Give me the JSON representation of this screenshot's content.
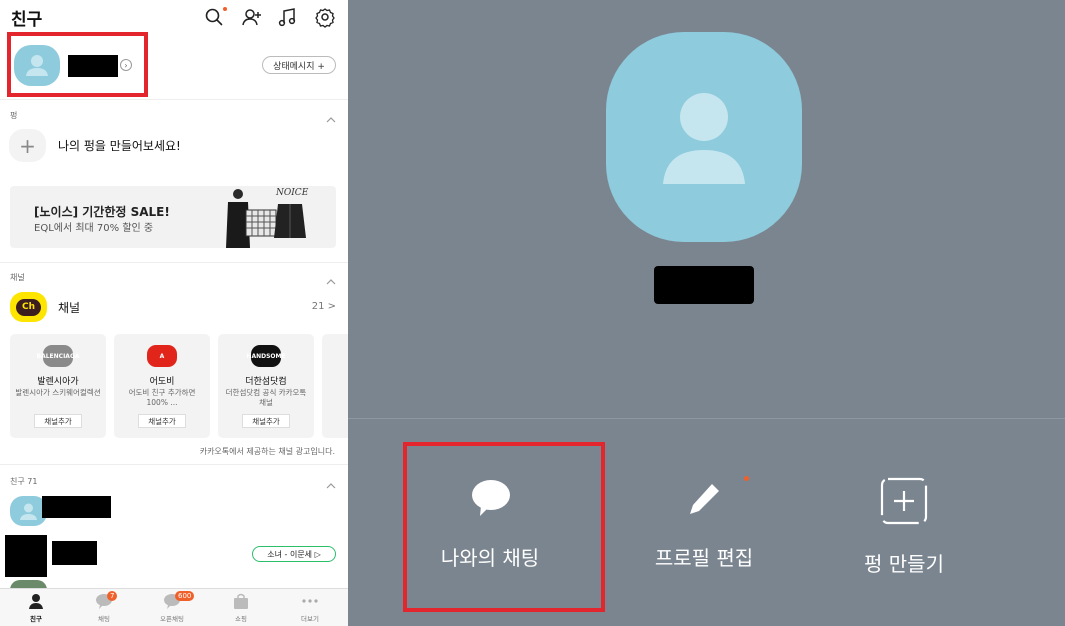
{
  "left": {
    "header": {
      "title": "친구",
      "icons": [
        "search-icon",
        "add-friend-icon",
        "music-icon",
        "settings-icon"
      ]
    },
    "profile": {
      "status_button": "상태메시지 +"
    },
    "pyeong": {
      "section_label": "펑",
      "create_text": "나의 펑을 만들어보세요!"
    },
    "banner": {
      "title": "[노이스] 기간한정 SALE!",
      "subtitle": "EQL에서 최대 70% 할인 중",
      "brand": "NOICE"
    },
    "channel": {
      "section_label": "채널",
      "logo_text": "Ch",
      "title": "채널",
      "count": "21 >",
      "cards": [
        {
          "name": "발렌시아가",
          "desc": "발렌시아가 스키웨어컬렉션",
          "button": "채널추가",
          "logo_text": "BALENCIAGA",
          "logo_color": "#8a8a8a"
        },
        {
          "name": "어도비",
          "desc": "어도비 친구 추가하면 100% ...",
          "button": "채널추가",
          "logo_text": "A",
          "logo_color": "#e1251b"
        },
        {
          "name": "더한섬닷컴",
          "desc": "더한섬닷컴 공식 카카오톡 채널",
          "button": "채널추가",
          "logo_text": "HANDSOME",
          "logo_color": "#111111"
        }
      ],
      "ad_note": "카카오톡에서 제공하는 채널 광고입니다."
    },
    "friends": {
      "section_label": "친구 71",
      "music_label": "소녀 - 이문세 ▷"
    },
    "tabs": [
      {
        "label": "친구",
        "badge": ""
      },
      {
        "label": "채팅",
        "badge": "7"
      },
      {
        "label": "오픈채팅",
        "badge": "600"
      },
      {
        "label": "쇼핑",
        "badge": ""
      },
      {
        "label": "더보기",
        "badge": ""
      }
    ]
  },
  "right": {
    "actions": [
      {
        "label": "나와의 채팅",
        "icon": "chat-bubble-icon"
      },
      {
        "label": "프로필 편집",
        "icon": "pencil-icon"
      },
      {
        "label": "펑 만들기",
        "icon": "add-pyeong-icon"
      }
    ]
  },
  "colors": {
    "accent_red": "#e3262d",
    "avatar_blue": "#8ecbdd",
    "right_bg": "#7b8590",
    "kakao_yellow": "#fee500",
    "badge_orange": "#f0602a"
  }
}
